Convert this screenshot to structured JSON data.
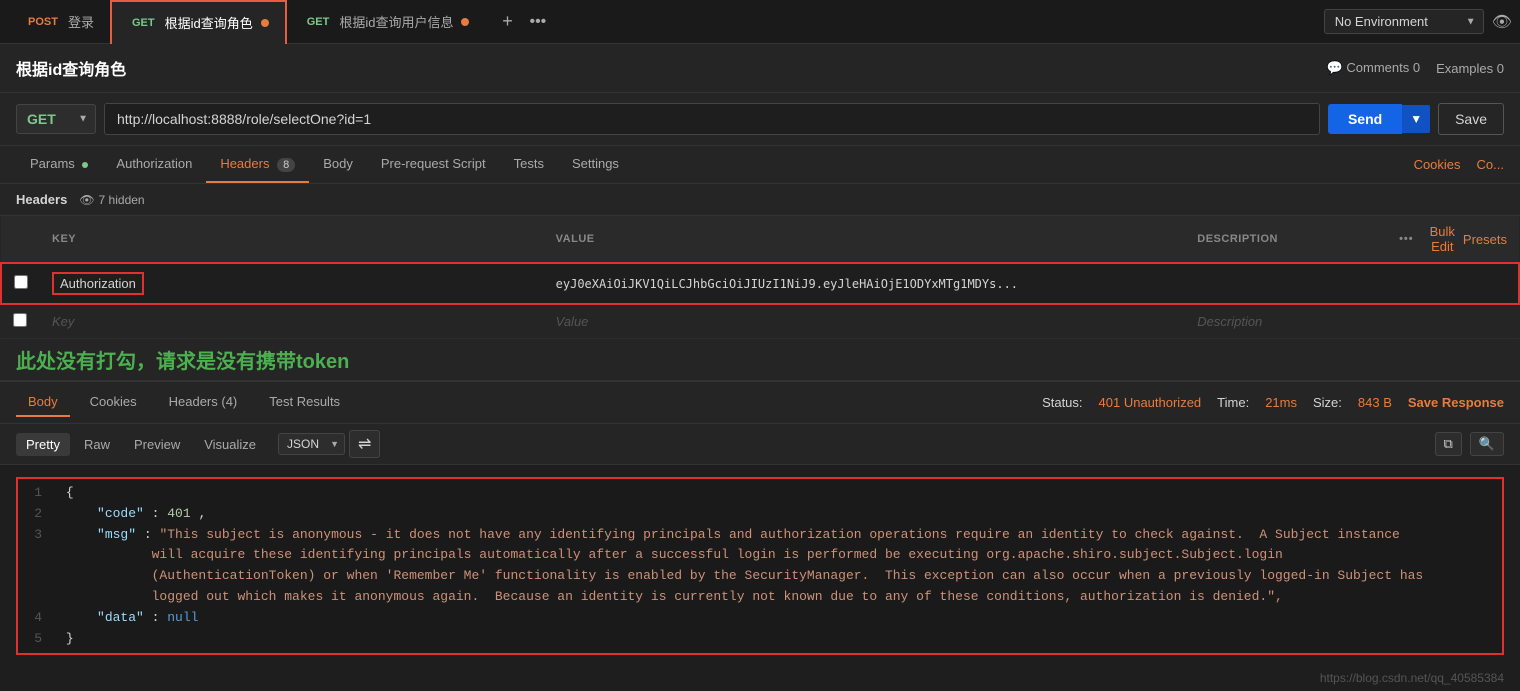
{
  "env": {
    "label": "No Environment",
    "placeholder": "No Environment"
  },
  "tabs": [
    {
      "id": "tab-post-login",
      "method": "POST",
      "label": "登录",
      "active": false
    },
    {
      "id": "tab-get-role",
      "method": "GET",
      "label": "根据id查询角色",
      "active": true,
      "dot": true
    },
    {
      "id": "tab-get-user",
      "method": "GET",
      "label": "根据id查询用户信息",
      "active": false,
      "dot": true
    }
  ],
  "page_title": "根据id查询角色",
  "title_actions": {
    "comments": "Comments  0",
    "examples": "Examples  0"
  },
  "url_bar": {
    "method": "GET",
    "url": "http://localhost:8888/role/selectOne?id=1",
    "send_label": "Send",
    "save_label": "Save"
  },
  "request_tabs": [
    {
      "id": "params",
      "label": "Params",
      "dot": true,
      "active": false
    },
    {
      "id": "authorization",
      "label": "Authorization",
      "active": false
    },
    {
      "id": "headers",
      "label": "Headers",
      "badge": "8",
      "active": true
    },
    {
      "id": "body",
      "label": "Body",
      "active": false
    },
    {
      "id": "pre-request",
      "label": "Pre-request Script",
      "active": false
    },
    {
      "id": "tests",
      "label": "Tests",
      "active": false
    },
    {
      "id": "settings",
      "label": "Settings",
      "active": false
    }
  ],
  "tab_right_actions": {
    "cookies": "Cookies",
    "co": "Co..."
  },
  "headers_section": {
    "label": "Headers",
    "hidden_text": "7 hidden"
  },
  "table": {
    "columns": [
      "KEY",
      "VALUE",
      "DESCRIPTION"
    ],
    "actions": {
      "three_dots": "•••",
      "bulk_edit": "Bulk Edit",
      "presets": "Presets"
    },
    "rows": [
      {
        "id": "auth-row",
        "checked": false,
        "key": "Authorization",
        "value": "eyJ0eXAiOiJKV1QiLCJhbGciOiJIUzI1NiJ9.eyJleHAiOjE1ODYxMTg1MDYs...",
        "description": "",
        "highlighted": true
      },
      {
        "id": "empty-row",
        "checked": false,
        "key": "",
        "value": "Value",
        "description": "Description",
        "highlighted": false
      }
    ]
  },
  "annotation": {
    "text": "此处没有打勾，请求是没有携带token"
  },
  "response": {
    "tabs": [
      "Body",
      "Cookies",
      "Headers (4)",
      "Test Results"
    ],
    "active_tab": "Body",
    "status_label": "Status:",
    "status_value": "401 Unauthorized",
    "time_label": "Time:",
    "time_value": "21ms",
    "size_label": "Size:",
    "size_value": "843 B",
    "save_response": "Save Response",
    "view_tabs": [
      "Pretty",
      "Raw",
      "Preview",
      "Visualize"
    ],
    "active_view": "Pretty",
    "format": "JSON",
    "json_lines": [
      {
        "num": 1,
        "content": "{"
      },
      {
        "num": 2,
        "content": "    \"code\": 401,"
      },
      {
        "num": 3,
        "content": "    \"msg\": \"This subject is anonymous - it does not have any identifying principals and authorization operations require an identity to check against.  A Subject instance\\n           will acquire these identifying principals automatically after a successful login is performed be executing org.apache.shiro.subject.Subject.login\\n           (AuthenticationToken) or when 'Remember Me' functionality is enabled by the SecurityManager.  This exception can also occur when a previously logged-in Subject has\\n           logged out which makes it anonymous again.  Because an identity is currently not known due to any of these conditions, authorization is denied.\","
      },
      {
        "num": 4,
        "content": "    \"data\": null"
      },
      {
        "num": 5,
        "content": "}"
      }
    ]
  },
  "watermark": "https://blog.csdn.net/qq_40585384"
}
